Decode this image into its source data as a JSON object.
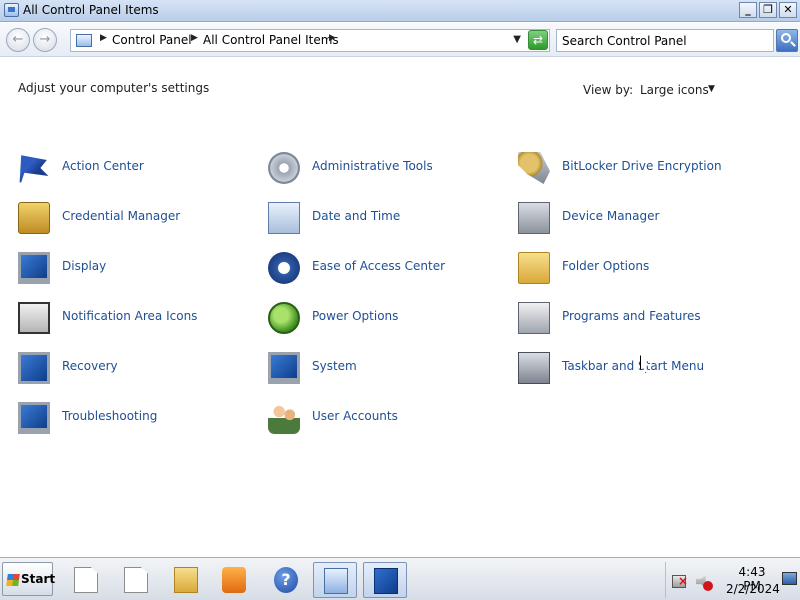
{
  "window": {
    "title": "All Control Panel Items",
    "min_label": "_",
    "max_label": "❐",
    "close_label": "✕"
  },
  "addressbar": {
    "back_label": "←",
    "forward_label": "→",
    "crumb_sep": "▶",
    "breadcrumbs": [
      "Control Panel",
      "All Control Panel Items"
    ],
    "dropdown_arrow": "▼",
    "refresh_label": "⇄",
    "search_placeholder": "Search Control Panel"
  },
  "header": {
    "adjust_label": "Adjust your computer's settings",
    "viewby_label": "View by:",
    "viewby_value": "Large icons",
    "viewby_arrow": "▼"
  },
  "items": [
    {
      "label": "Action Center",
      "icon": "action-center-flag-icon"
    },
    {
      "label": "Administrative Tools",
      "icon": "administrative-tools-icon"
    },
    {
      "label": "BitLocker Drive Encryption",
      "icon": "bitlocker-key-icon"
    },
    {
      "label": "Credential Manager",
      "icon": "credential-vault-icon"
    },
    {
      "label": "Date and Time",
      "icon": "date-time-clock-icon"
    },
    {
      "label": "Device Manager",
      "icon": "device-manager-icon"
    },
    {
      "label": "Display",
      "icon": "display-monitor-icon"
    },
    {
      "label": "Ease of Access Center",
      "icon": "ease-of-access-icon"
    },
    {
      "label": "Folder Options",
      "icon": "folder-options-icon"
    },
    {
      "label": "Notification Area Icons",
      "icon": "notification-area-icon"
    },
    {
      "label": "Power Options",
      "icon": "power-options-icon"
    },
    {
      "label": "Programs and Features",
      "icon": "programs-features-icon"
    },
    {
      "label": "Recovery",
      "icon": "recovery-icon"
    },
    {
      "label": "System",
      "icon": "system-icon"
    },
    {
      "label": "Taskbar and Start Menu",
      "icon": "taskbar-start-menu-icon"
    },
    {
      "label": "Troubleshooting",
      "icon": "troubleshooting-icon"
    },
    {
      "label": "User Accounts",
      "icon": "user-accounts-icon"
    }
  ],
  "taskbar": {
    "start_label": "Start",
    "help_glyph": "?",
    "time": "4:43 PM",
    "date": "2/2/2024"
  },
  "colors": {
    "link": "#1e4f94",
    "titlebar": "#b9cde9"
  }
}
